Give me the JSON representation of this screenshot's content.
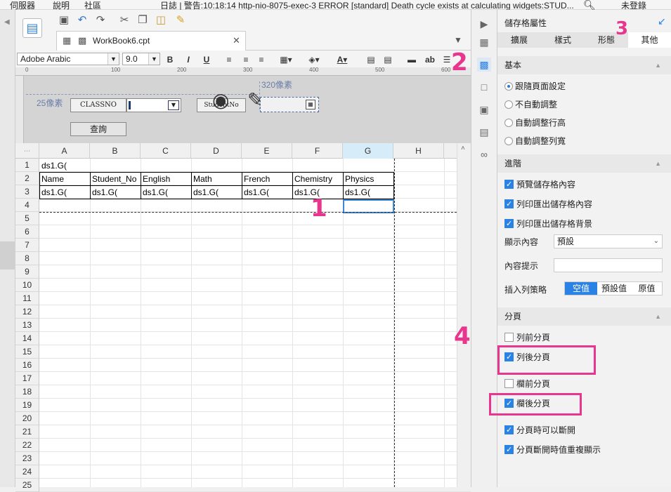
{
  "menu": {
    "items": [
      "伺服器",
      "說明",
      "社區"
    ],
    "log_message": "日誌 | 警告:10:18:14 http-nio-8075-exec-3 ERROR [standard] Death cycle exists at calculating widgets:STUD...",
    "login": "未登錄"
  },
  "tab": {
    "title": "WorkBook6.cpt"
  },
  "font": {
    "family": "Adobe Arabic",
    "size": "9.0"
  },
  "fontbar": {
    "bold": "B",
    "italic": "I",
    "underline": "U",
    "ab": "ab"
  },
  "ruler": {
    "marks": [
      "0",
      "100",
      "200",
      "300",
      "400",
      "500",
      "600"
    ]
  },
  "design": {
    "pixels_left": "25像素",
    "pixels_top": "320像素",
    "classno_label": "CLASSNO",
    "studentno_label": "StudentNo",
    "query_button": "查詢"
  },
  "sheet": {
    "columns": [
      "A",
      "B",
      "C",
      "D",
      "E",
      "F",
      "G",
      "H"
    ],
    "rows": [
      "1",
      "2",
      "3",
      "4",
      "5",
      "6",
      "7",
      "8",
      "9",
      "10",
      "11",
      "12",
      "13",
      "14",
      "15",
      "16",
      "17",
      "18",
      "19",
      "20",
      "21",
      "22",
      "23",
      "24",
      "25"
    ],
    "row1": [
      "ds1.G("
    ],
    "row2": [
      "Name",
      "Student_No",
      "English",
      "Math",
      "French",
      "Chemistry",
      "Physics"
    ],
    "row3": [
      "ds1.G(",
      "ds1.G(",
      "ds1.G(",
      "ds1.G(",
      "ds1.G(",
      "ds1.G(",
      "ds1.G("
    ]
  },
  "panel": {
    "title": "儲存格屬性",
    "tabs": [
      "擴展",
      "樣式",
      "形態",
      "其他"
    ],
    "basic": {
      "title": "基本",
      "options": [
        "跟隨頁面設定",
        "不自動調整",
        "自動調整行高",
        "自動調整列寬"
      ]
    },
    "advanced": {
      "title": "進階",
      "checks": [
        "預覽儲存格內容",
        "列印匯出儲存格內容",
        "列印匯出儲存格背景"
      ],
      "display_label": "顯示內容",
      "display_value": "預設",
      "hint_label": "內容提示",
      "insert_label": "插入列策略",
      "insert_options": [
        "空值",
        "預設值",
        "原值"
      ]
    },
    "paging": {
      "title": "分頁",
      "checks": [
        "列前分頁",
        "列後分頁",
        "欄前分頁",
        "欄後分頁",
        "分頁時可以斷開",
        "分頁斷開時值重複顯示"
      ]
    }
  },
  "annotations": [
    "1",
    "2",
    "3",
    "4"
  ],
  "colors": {
    "accent": "#2a82e4",
    "highlight": "#e8358d"
  }
}
